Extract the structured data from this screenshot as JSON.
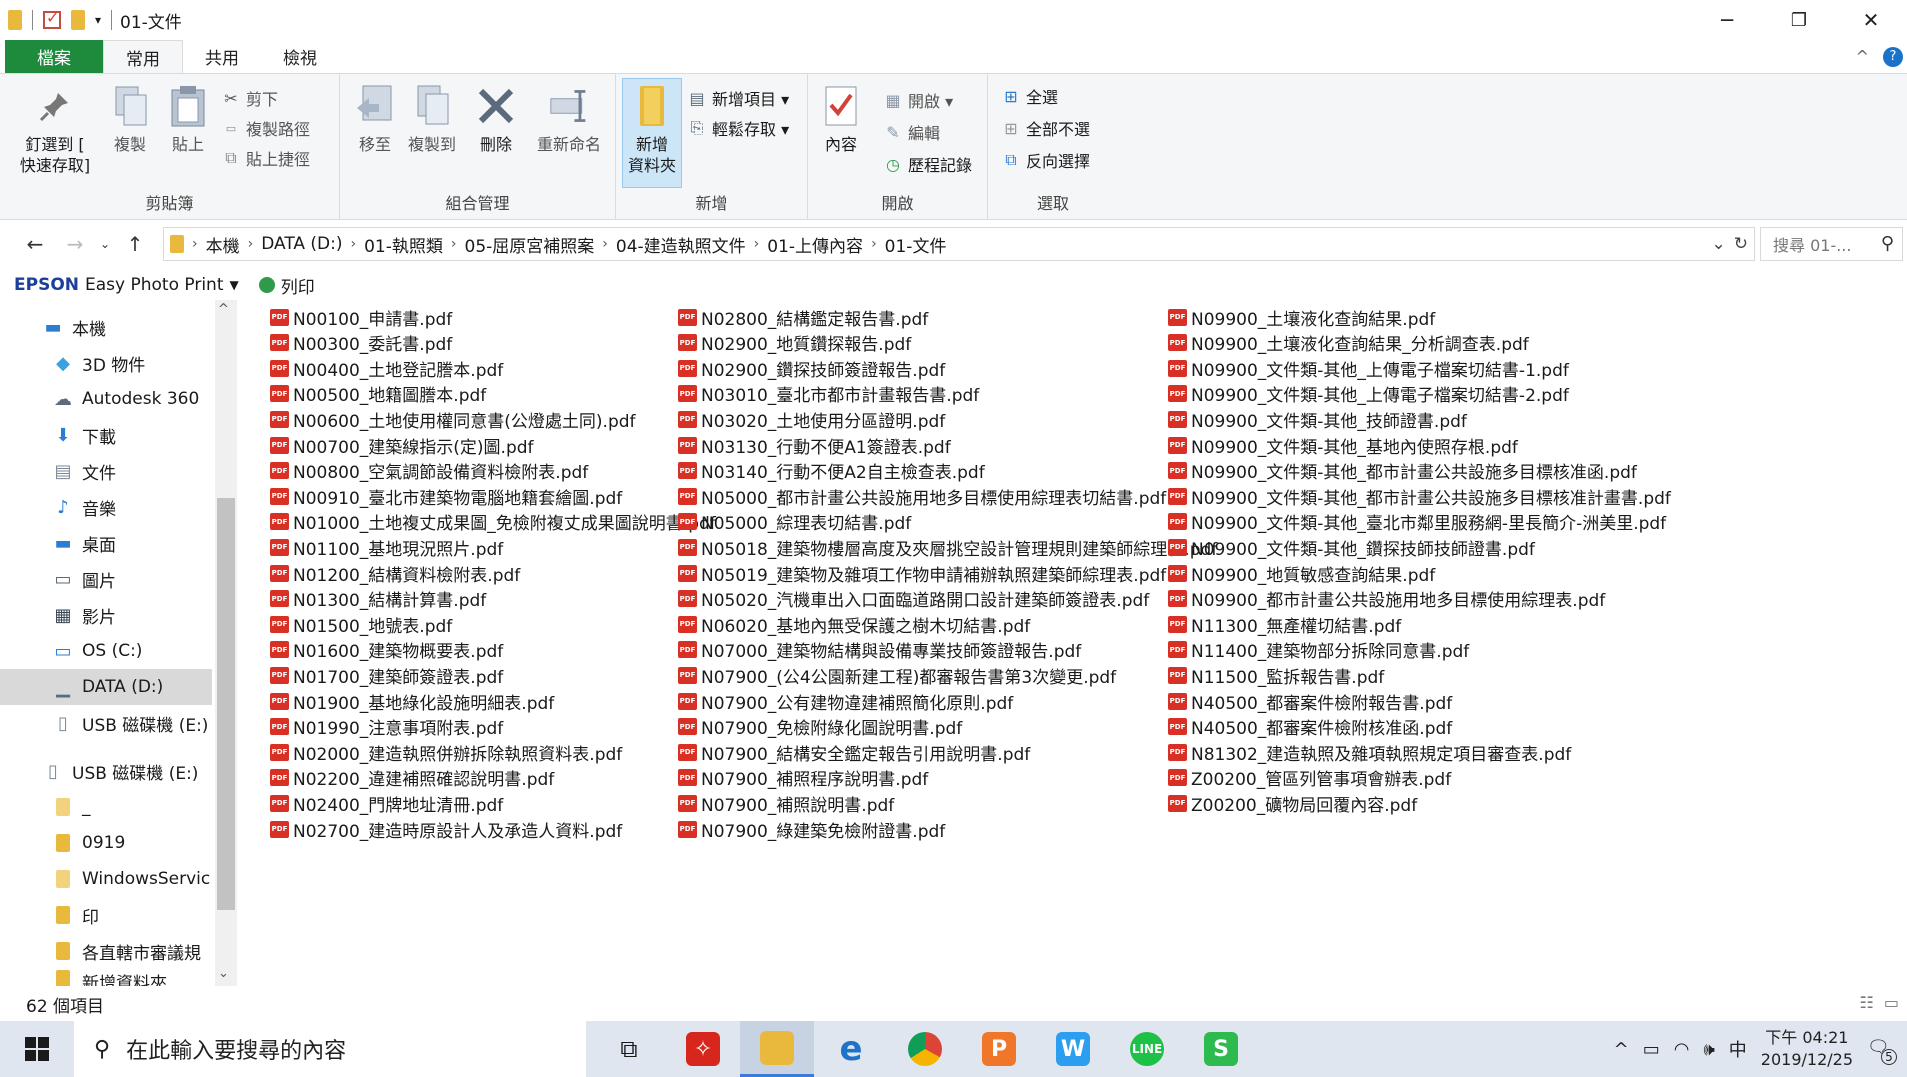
{
  "window": {
    "title": "01-文件",
    "minimize": "─",
    "maximize": "❐",
    "close": "✕"
  },
  "tabs": {
    "file": "檔案",
    "home": "常用",
    "share": "共用",
    "view": "檢視",
    "collapse": "^",
    "help": "?"
  },
  "ribbon": {
    "clipboard": {
      "label": "剪貼簿",
      "pin": "釘選到 [\n快速存取]",
      "copy": "複製",
      "paste": "貼上",
      "cut": "剪下",
      "copy_path": "複製路徑",
      "paste_shortcut": "貼上捷徑"
    },
    "organize": {
      "label": "組合管理",
      "move_to": "移至",
      "copy_to": "複製到",
      "delete": "刪除",
      "rename": "重新命名"
    },
    "new": {
      "label": "新增",
      "new_folder": "新增\n資料夾",
      "new_item": "新增項目 ▾",
      "easy_access": "輕鬆存取 ▾"
    },
    "open": {
      "label": "開啟",
      "properties": "內容",
      "open": "開啟 ▾",
      "edit": "編輯",
      "history": "歷程記錄"
    },
    "select": {
      "label": "選取",
      "select_all": "全選",
      "select_none": "全部不選",
      "invert": "反向選擇"
    }
  },
  "address": {
    "crumbs": [
      "本機",
      "DATA (D:)",
      "01-執照類",
      "05-屈原宮補照案",
      "04-建造執照文件",
      "01-上傳內容",
      "01-文件"
    ],
    "search_placeholder": "搜尋 01-..."
  },
  "epson": {
    "brand": "EPSON",
    "app": "Easy Photo Print",
    "print": "列印"
  },
  "nav": [
    {
      "label": "本機",
      "icon": "computer-icon"
    },
    {
      "label": "3D 物件",
      "icon": "3d-objects-icon"
    },
    {
      "label": "Autodesk 360",
      "icon": "cloud-icon"
    },
    {
      "label": "下載",
      "icon": "download-icon"
    },
    {
      "label": "文件",
      "icon": "document-icon"
    },
    {
      "label": "音樂",
      "icon": "music-icon"
    },
    {
      "label": "桌面",
      "icon": "desktop-icon"
    },
    {
      "label": "圖片",
      "icon": "pictures-icon"
    },
    {
      "label": "影片",
      "icon": "video-icon"
    },
    {
      "label": "OS (C:)",
      "icon": "os-drive-icon"
    },
    {
      "label": "DATA (D:)",
      "icon": "drive-icon"
    },
    {
      "label": "USB 磁碟機 (E:)",
      "icon": "usb-drive-icon"
    },
    {
      "label": "USB 磁碟機 (E:)",
      "icon": "usb-drive-icon"
    },
    {
      "label": "_",
      "icon": "folder-icon"
    },
    {
      "label": "0919",
      "icon": "folder-icon"
    },
    {
      "label": "WindowsServic",
      "icon": "folder-icon"
    },
    {
      "label": "印",
      "icon": "folder-icon"
    },
    {
      "label": "各直轄市審議規",
      "icon": "folder-icon"
    },
    {
      "label": "新增資料夾",
      "icon": "folder-icon"
    }
  ],
  "files": [
    "N00100_申請書.pdf",
    "N00300_委託書.pdf",
    "N00400_土地登記謄本.pdf",
    "N00500_地籍圖謄本.pdf",
    "N00600_土地使用權同意書(公燈處土同).pdf",
    "N00700_建築線指示(定)圖.pdf",
    "N00800_空氣調節設備資料檢附表.pdf",
    "N00910_臺北市建築物電腦地籍套繪圖.pdf",
    "N01000_土地複丈成果圖_免檢附複丈成果圖說明書.pdf",
    "N01100_基地現況照片.pdf",
    "N01200_結構資料檢附表.pdf",
    "N01300_結構計算書.pdf",
    "N01500_地號表.pdf",
    "N01600_建築物概要表.pdf",
    "N01700_建築師簽證表.pdf",
    "N01900_基地綠化設施明細表.pdf",
    "N01990_注意事項附表.pdf",
    "N02000_建造執照併辦拆除執照資料表.pdf",
    "N02200_違建補照確認說明書.pdf",
    "N02400_門牌地址清冊.pdf",
    "N02700_建造時原設計人及承造人資料.pdf",
    "N02800_結構鑑定報告書.pdf",
    "N02900_地質鑽探報告.pdf",
    "N02900_鑽探技師簽證報告.pdf",
    "N03010_臺北市都市計畫報告書.pdf",
    "N03020_土地使用分區證明.pdf",
    "N03130_行動不便A1簽證表.pdf",
    "N03140_行動不便A2自主檢查表.pdf",
    "N05000_都市計畫公共設施用地多目標使用綜理表切結書.pdf",
    "N05000_綜理表切結書.pdf",
    "N05018_建築物樓層高度及夾層挑空設計管理規則建築師綜理表.pdf",
    "N05019_建築物及雜項工作物申請補辦執照建築師綜理表.pdf",
    "N05020_汽機車出入口面臨道路開口設計建築師簽證表.pdf",
    "N06020_基地內無受保護之樹木切結書.pdf",
    "N07000_建築物結構與設備專業技師簽證報告.pdf",
    "N07900_(公4公園新建工程)都審報告書第3次變更.pdf",
    "N07900_公有建物違建補照簡化原則.pdf",
    "N07900_免檢附綠化圖說明書.pdf",
    "N07900_結構安全鑑定報告引用說明書.pdf",
    "N07900_補照程序說明書.pdf",
    "N07900_補照說明書.pdf",
    "N07900_綠建築免檢附證書.pdf",
    "N09900_土壤液化查詢結果.pdf",
    "N09900_土壤液化查詢結果_分析調查表.pdf",
    "N09900_文件類-其他_上傳電子檔案切結書-1.pdf",
    "N09900_文件類-其他_上傳電子檔案切結書-2.pdf",
    "N09900_文件類-其他_技師證書.pdf",
    "N09900_文件類-其他_基地內使照存根.pdf",
    "N09900_文件類-其他_都市計畫公共設施多目標核准函.pdf",
    "N09900_文件類-其他_都市計畫公共設施多目標核准計畫書.pdf",
    "N09900_文件類-其他_臺北市鄰里服務網-里長簡介-洲美里.pdf",
    "N09900_文件類-其他_鑽探技師技師證書.pdf",
    "N09900_地質敏感查詢結果.pdf",
    "N09900_都市計畫公共設施用地多目標使用綜理表.pdf",
    "N11300_無產權切結書.pdf",
    "N11400_建築物部分拆除同意書.pdf",
    "N11500_監拆報告書.pdf",
    "N40500_都審案件檢附報告書.pdf",
    "N40500_都審案件檢附核准函.pdf",
    "N81302_建造執照及雜項執照規定項目審查表.pdf",
    "Z00200_管區列管事項會辦表.pdf",
    "Z00200_礦物局回覆內容.pdf"
  ],
  "status": {
    "count": "62 個項目"
  },
  "taskbar": {
    "search_placeholder": "在此輸入要搜尋的內容",
    "ime": "中",
    "time": "下午 04:21",
    "date": "2019/12/25",
    "notif_count": "5"
  },
  "colors": {
    "file_tab": "#1e8a3b",
    "pdf_icon": "#d93025",
    "folder": "#e9b93d",
    "selected": "#d9d9d9",
    "taskbar": "#dfe6ef"
  }
}
